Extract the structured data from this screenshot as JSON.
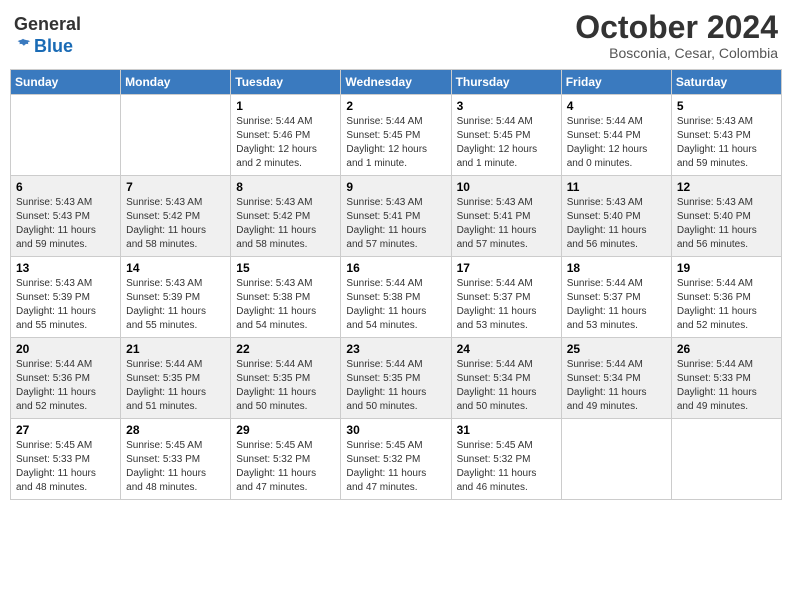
{
  "logo": {
    "general": "General",
    "blue": "Blue"
  },
  "header": {
    "month": "October 2024",
    "location": "Bosconia, Cesar, Colombia"
  },
  "days_of_week": [
    "Sunday",
    "Monday",
    "Tuesday",
    "Wednesday",
    "Thursday",
    "Friday",
    "Saturday"
  ],
  "weeks": [
    [
      {
        "day": "",
        "info": ""
      },
      {
        "day": "",
        "info": ""
      },
      {
        "day": "1",
        "info": "Sunrise: 5:44 AM\nSunset: 5:46 PM\nDaylight: 12 hours\nand 2 minutes."
      },
      {
        "day": "2",
        "info": "Sunrise: 5:44 AM\nSunset: 5:45 PM\nDaylight: 12 hours\nand 1 minute."
      },
      {
        "day": "3",
        "info": "Sunrise: 5:44 AM\nSunset: 5:45 PM\nDaylight: 12 hours\nand 1 minute."
      },
      {
        "day": "4",
        "info": "Sunrise: 5:44 AM\nSunset: 5:44 PM\nDaylight: 12 hours\nand 0 minutes."
      },
      {
        "day": "5",
        "info": "Sunrise: 5:43 AM\nSunset: 5:43 PM\nDaylight: 11 hours\nand 59 minutes."
      }
    ],
    [
      {
        "day": "6",
        "info": "Sunrise: 5:43 AM\nSunset: 5:43 PM\nDaylight: 11 hours\nand 59 minutes."
      },
      {
        "day": "7",
        "info": "Sunrise: 5:43 AM\nSunset: 5:42 PM\nDaylight: 11 hours\nand 58 minutes."
      },
      {
        "day": "8",
        "info": "Sunrise: 5:43 AM\nSunset: 5:42 PM\nDaylight: 11 hours\nand 58 minutes."
      },
      {
        "day": "9",
        "info": "Sunrise: 5:43 AM\nSunset: 5:41 PM\nDaylight: 11 hours\nand 57 minutes."
      },
      {
        "day": "10",
        "info": "Sunrise: 5:43 AM\nSunset: 5:41 PM\nDaylight: 11 hours\nand 57 minutes."
      },
      {
        "day": "11",
        "info": "Sunrise: 5:43 AM\nSunset: 5:40 PM\nDaylight: 11 hours\nand 56 minutes."
      },
      {
        "day": "12",
        "info": "Sunrise: 5:43 AM\nSunset: 5:40 PM\nDaylight: 11 hours\nand 56 minutes."
      }
    ],
    [
      {
        "day": "13",
        "info": "Sunrise: 5:43 AM\nSunset: 5:39 PM\nDaylight: 11 hours\nand 55 minutes."
      },
      {
        "day": "14",
        "info": "Sunrise: 5:43 AM\nSunset: 5:39 PM\nDaylight: 11 hours\nand 55 minutes."
      },
      {
        "day": "15",
        "info": "Sunrise: 5:43 AM\nSunset: 5:38 PM\nDaylight: 11 hours\nand 54 minutes."
      },
      {
        "day": "16",
        "info": "Sunrise: 5:44 AM\nSunset: 5:38 PM\nDaylight: 11 hours\nand 54 minutes."
      },
      {
        "day": "17",
        "info": "Sunrise: 5:44 AM\nSunset: 5:37 PM\nDaylight: 11 hours\nand 53 minutes."
      },
      {
        "day": "18",
        "info": "Sunrise: 5:44 AM\nSunset: 5:37 PM\nDaylight: 11 hours\nand 53 minutes."
      },
      {
        "day": "19",
        "info": "Sunrise: 5:44 AM\nSunset: 5:36 PM\nDaylight: 11 hours\nand 52 minutes."
      }
    ],
    [
      {
        "day": "20",
        "info": "Sunrise: 5:44 AM\nSunset: 5:36 PM\nDaylight: 11 hours\nand 52 minutes."
      },
      {
        "day": "21",
        "info": "Sunrise: 5:44 AM\nSunset: 5:35 PM\nDaylight: 11 hours\nand 51 minutes."
      },
      {
        "day": "22",
        "info": "Sunrise: 5:44 AM\nSunset: 5:35 PM\nDaylight: 11 hours\nand 50 minutes."
      },
      {
        "day": "23",
        "info": "Sunrise: 5:44 AM\nSunset: 5:35 PM\nDaylight: 11 hours\nand 50 minutes."
      },
      {
        "day": "24",
        "info": "Sunrise: 5:44 AM\nSunset: 5:34 PM\nDaylight: 11 hours\nand 50 minutes."
      },
      {
        "day": "25",
        "info": "Sunrise: 5:44 AM\nSunset: 5:34 PM\nDaylight: 11 hours\nand 49 minutes."
      },
      {
        "day": "26",
        "info": "Sunrise: 5:44 AM\nSunset: 5:33 PM\nDaylight: 11 hours\nand 49 minutes."
      }
    ],
    [
      {
        "day": "27",
        "info": "Sunrise: 5:45 AM\nSunset: 5:33 PM\nDaylight: 11 hours\nand 48 minutes."
      },
      {
        "day": "28",
        "info": "Sunrise: 5:45 AM\nSunset: 5:33 PM\nDaylight: 11 hours\nand 48 minutes."
      },
      {
        "day": "29",
        "info": "Sunrise: 5:45 AM\nSunset: 5:32 PM\nDaylight: 11 hours\nand 47 minutes."
      },
      {
        "day": "30",
        "info": "Sunrise: 5:45 AM\nSunset: 5:32 PM\nDaylight: 11 hours\nand 47 minutes."
      },
      {
        "day": "31",
        "info": "Sunrise: 5:45 AM\nSunset: 5:32 PM\nDaylight: 11 hours\nand 46 minutes."
      },
      {
        "day": "",
        "info": ""
      },
      {
        "day": "",
        "info": ""
      }
    ]
  ]
}
